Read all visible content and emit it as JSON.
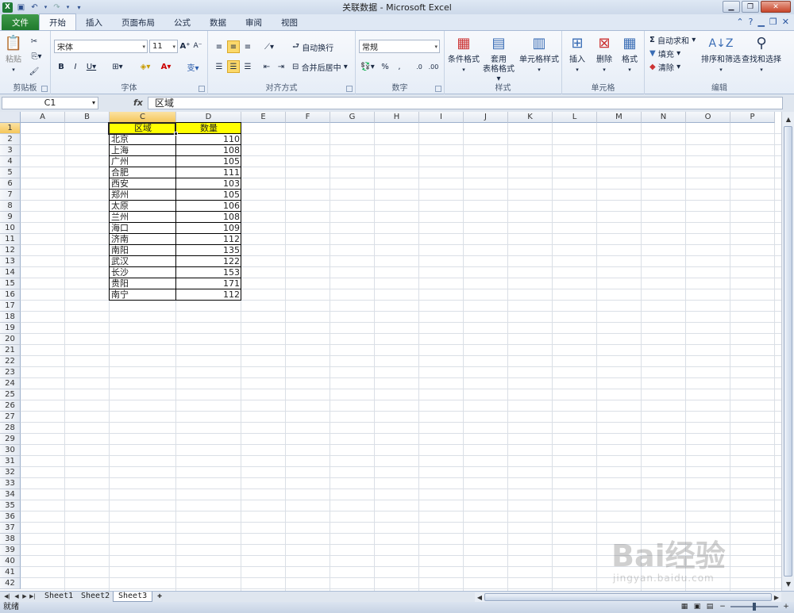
{
  "window": {
    "title": "关联数据 - Microsoft Excel"
  },
  "tabs": [
    "文件",
    "开始",
    "插入",
    "页面布局",
    "公式",
    "数据",
    "审阅",
    "视图"
  ],
  "ribbon": {
    "clipboard": {
      "label": "剪贴板",
      "paste": "粘贴"
    },
    "font": {
      "label": "字体",
      "name": "宋体",
      "size": "11"
    },
    "alignment": {
      "label": "对齐方式",
      "wrap": "自动换行",
      "merge": "合并后居中"
    },
    "number": {
      "label": "数字",
      "format": "常规"
    },
    "styles": {
      "label": "样式",
      "conditional": "条件格式",
      "table_line1": "套用",
      "table_line2": "表格格式",
      "cell_styles": "单元格样式"
    },
    "cells": {
      "label": "单元格",
      "insert": "插入",
      "delete": "删除",
      "format": "格式"
    },
    "editing": {
      "label": "编辑",
      "autosum": "自动求和",
      "fill": "填充",
      "clear": "清除",
      "sort": "排序和筛选",
      "find": "查找和选择"
    }
  },
  "formula_bar": {
    "name_box": "C1",
    "fx": "fx",
    "content": "区域"
  },
  "columns": [
    "A",
    "B",
    "C",
    "D",
    "E",
    "F",
    "G",
    "H",
    "I",
    "J",
    "K",
    "L",
    "M",
    "N",
    "O",
    "P"
  ],
  "rows": [
    "1",
    "2",
    "3",
    "4",
    "5",
    "6",
    "7",
    "8",
    "9",
    "10",
    "11",
    "12",
    "13",
    "14",
    "15",
    "16",
    "17",
    "18",
    "19",
    "20",
    "21",
    "22",
    "23",
    "24",
    "25",
    "26",
    "27",
    "28",
    "29",
    "30",
    "31",
    "32",
    "33",
    "34",
    "35",
    "36",
    "37",
    "38",
    "39",
    "40",
    "41",
    "42"
  ],
  "table": {
    "headers": [
      "区域",
      "数量"
    ],
    "rows": [
      [
        "北京",
        "110"
      ],
      [
        "上海",
        "108"
      ],
      [
        "广州",
        "105"
      ],
      [
        "合肥",
        "111"
      ],
      [
        "西安",
        "103"
      ],
      [
        "郑州",
        "105"
      ],
      [
        "太原",
        "106"
      ],
      [
        "兰州",
        "108"
      ],
      [
        "海口",
        "109"
      ],
      [
        "济南",
        "112"
      ],
      [
        "南阳",
        "135"
      ],
      [
        "武汉",
        "122"
      ],
      [
        "长沙",
        "153"
      ],
      [
        "贵阳",
        "171"
      ],
      [
        "南宁",
        "112"
      ]
    ]
  },
  "sheets": [
    "Sheet1",
    "Sheet2",
    "Sheet3"
  ],
  "status": {
    "ready": "就绪"
  },
  "watermark": {
    "main": "Bai经验",
    "sub": "jingyan.baidu.com"
  },
  "colors": {
    "header_fill": "#ffff00",
    "selected_header": "#f5c75b",
    "file_tab": "#1f7a2d"
  }
}
